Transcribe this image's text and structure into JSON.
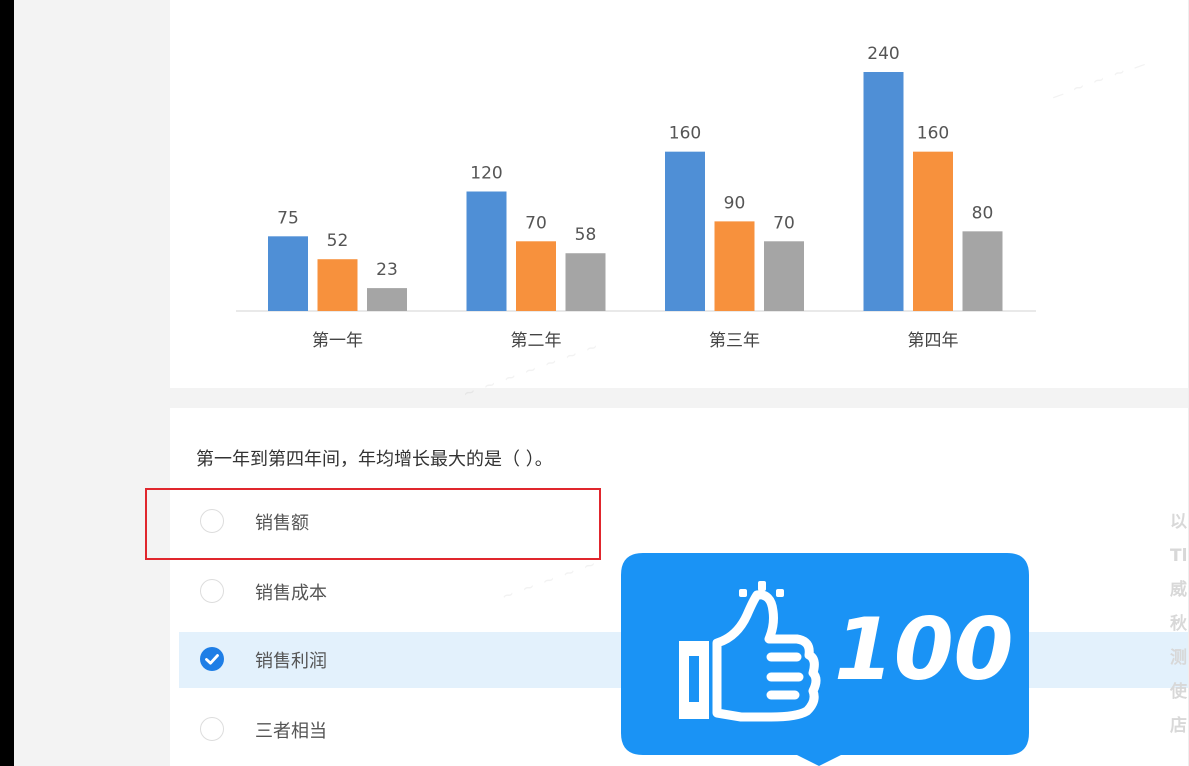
{
  "chart_data": {
    "type": "bar",
    "categories": [
      "第一年",
      "第二年",
      "第三年",
      "第四年"
    ],
    "series": [
      {
        "values": [
          75,
          120,
          160,
          240
        ],
        "color": "#4f8fd6"
      },
      {
        "values": [
          52,
          70,
          90,
          160
        ],
        "color": "#f7913d"
      },
      {
        "values": [
          23,
          58,
          70,
          80
        ],
        "color": "#a5a5a5"
      }
    ],
    "ylim": [
      0,
      240
    ],
    "grid": false,
    "data_labels": true
  },
  "question": {
    "text": "第一年到第四年间，年均增长最大的是（ ）。",
    "options": [
      {
        "label": "销售额",
        "selected": false
      },
      {
        "label": "销售成本",
        "selected": false
      },
      {
        "label": "销售利润",
        "selected": true
      },
      {
        "label": "三者相当",
        "selected": false
      }
    ]
  },
  "side_text": [
    "以",
    "Tl",
    "威",
    "秋",
    "测",
    "使",
    "店"
  ],
  "sticker": {
    "count": "100",
    "icon": "thumbs-up-icon",
    "color": "#1a93f5"
  },
  "colors": {
    "highlight": "#e0262d",
    "selected_bg": "#e3f1fc",
    "check": "#1e7ee6"
  }
}
